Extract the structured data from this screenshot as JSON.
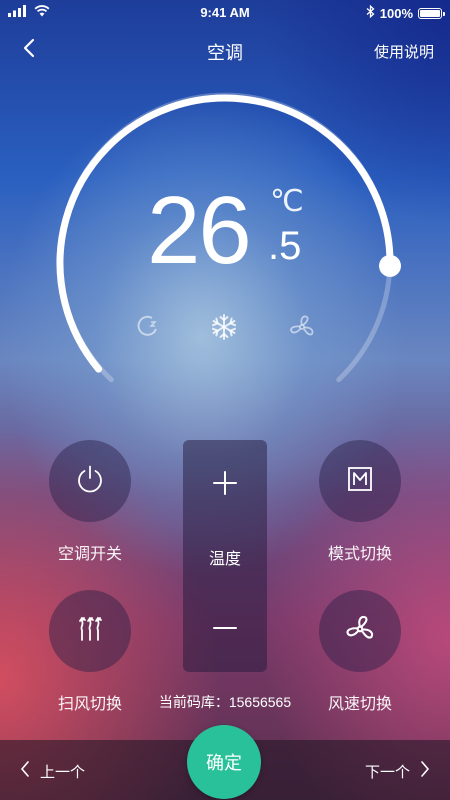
{
  "status_bar": {
    "time": "9:41 AM",
    "battery": "100%"
  },
  "nav": {
    "title": "空调",
    "manual_link": "使用说明"
  },
  "temperature": {
    "integer": "26",
    "decimal": ".5",
    "unit": "℃",
    "level": 0.85
  },
  "mode_icons": [
    "sleep-icon",
    "snowflake-icon",
    "fan-icon"
  ],
  "controls": {
    "power_label": "空调开关",
    "mode_label": "模式切换",
    "swing_label": "扫风切换",
    "fan_speed_label": "风速切换",
    "temp_label": "温度"
  },
  "code_library": "当前码库：15656565",
  "bottom": {
    "prev_label": "上一个",
    "next_label": "下一个",
    "confirm_label": "确定"
  },
  "colors": {
    "accent": "#29c19a"
  }
}
